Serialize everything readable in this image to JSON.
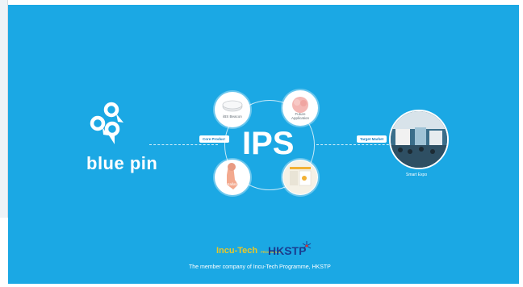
{
  "brand": {
    "name": "blue pin"
  },
  "center": {
    "title": "IPS"
  },
  "tags": {
    "left": "Core Product",
    "right": "Target Market"
  },
  "nodes": {
    "top_left": "iBS Beacon",
    "top_right": "Future Application",
    "bottom_left": "Installation",
    "bottom_right": ""
  },
  "market": {
    "caption": "Smart Expo"
  },
  "footer": {
    "logo_incu": "Incu-Tech",
    "logo_incu_sub": "PROGRAMME",
    "logo_hkstp": "HKSTP",
    "tagline": "The member company of Incu-Tech Programme, HKSTP"
  },
  "colors": {
    "background": "#1ba8e4",
    "accent_white": "#ffffff",
    "hkstp_blue": "#1a3c8f",
    "hkstp_red": "#e0302a"
  }
}
